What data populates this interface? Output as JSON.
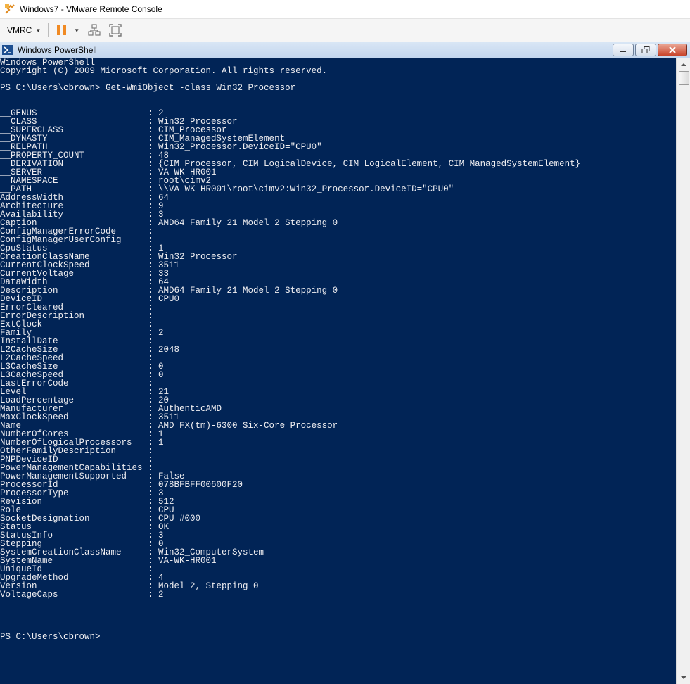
{
  "window": {
    "title": "Windows7 - VMware Remote Console"
  },
  "toolbar": {
    "vmrc_label": "VMRC"
  },
  "powershell": {
    "title": "Windows PowerShell"
  },
  "console": {
    "lines": [
      "Windows PowerShell",
      "Copyright (C) 2009 Microsoft Corporation. All rights reserved.",
      "",
      "PS C:\\Users\\cbrown> Get-WmiObject -class Win32_Processor",
      "",
      "",
      "__GENUS                     : 2",
      "__CLASS                     : Win32_Processor",
      "__SUPERCLASS                : CIM_Processor",
      "__DYNASTY                   : CIM_ManagedSystemElement",
      "__RELPATH                   : Win32_Processor.DeviceID=\"CPU0\"",
      "__PROPERTY_COUNT            : 48",
      "__DERIVATION                : {CIM_Processor, CIM_LogicalDevice, CIM_LogicalElement, CIM_ManagedSystemElement}",
      "__SERVER                    : VA-WK-HR001",
      "__NAMESPACE                 : root\\cimv2",
      "__PATH                      : \\\\VA-WK-HR001\\root\\cimv2:Win32_Processor.DeviceID=\"CPU0\"",
      "AddressWidth                : 64",
      "Architecture                : 9",
      "Availability                : 3",
      "Caption                     : AMD64 Family 21 Model 2 Stepping 0",
      "ConfigManagerErrorCode      :",
      "ConfigManagerUserConfig     :",
      "CpuStatus                   : 1",
      "CreationClassName           : Win32_Processor",
      "CurrentClockSpeed           : 3511",
      "CurrentVoltage              : 33",
      "DataWidth                   : 64",
      "Description                 : AMD64 Family 21 Model 2 Stepping 0",
      "DeviceID                    : CPU0",
      "ErrorCleared                :",
      "ErrorDescription            :",
      "ExtClock                    :",
      "Family                      : 2",
      "InstallDate                 :",
      "L2CacheSize                 : 2048",
      "L2CacheSpeed                :",
      "L3CacheSize                 : 0",
      "L3CacheSpeed                : 0",
      "LastErrorCode               :",
      "Level                       : 21",
      "LoadPercentage              : 20",
      "Manufacturer                : AuthenticAMD",
      "MaxClockSpeed               : 3511",
      "Name                        : AMD FX(tm)-6300 Six-Core Processor",
      "NumberOfCores               : 1",
      "NumberOfLogicalProcessors   : 1",
      "OtherFamilyDescription      :",
      "PNPDeviceID                 :",
      "PowerManagementCapabilities :",
      "PowerManagementSupported    : False",
      "ProcessorId                 : 078BFBFF00600F20",
      "ProcessorType               : 3",
      "Revision                    : 512",
      "Role                        : CPU",
      "SocketDesignation           : CPU #000",
      "Status                      : OK",
      "StatusInfo                  : 3",
      "Stepping                    : 0",
      "SystemCreationClassName     : Win32_ComputerSystem",
      "SystemName                  : VA-WK-HR001",
      "UniqueId                    :",
      "UpgradeMethod               : 4",
      "Version                     : Model 2, Stepping 0",
      "VoltageCaps                 : 2",
      "",
      "",
      "",
      "",
      "PS C:\\Users\\cbrown>"
    ]
  },
  "colors": {
    "console_bg": "#012456",
    "console_fg": "#eeedf0",
    "pause_accent": "#f08a24"
  },
  "icons": [
    "vmware-logo-icon",
    "chevron-down-icon",
    "pause-icon",
    "send-ctrl-alt-del-icon",
    "fullscreen-icon",
    "powershell-icon",
    "minimize-icon",
    "restore-icon",
    "close-icon",
    "scroll-up-arrow-icon",
    "scroll-down-arrow-icon"
  ]
}
